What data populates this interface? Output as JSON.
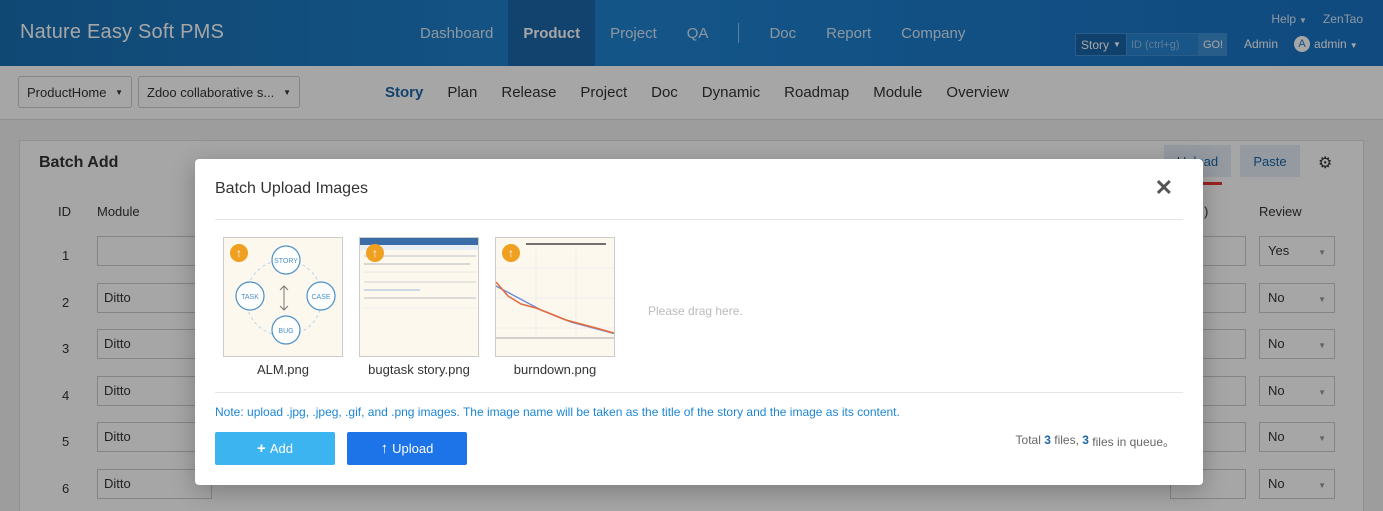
{
  "header": {
    "brand": "Nature Easy Soft PMS",
    "nav": [
      "Dashboard",
      "Product",
      "Project",
      "QA",
      "Doc",
      "Report",
      "Company"
    ],
    "active_nav": "Product",
    "help_label": "Help",
    "zentao_label": "ZenTao",
    "search_type": "Story",
    "search_placeholder": "ID (ctrl+g)",
    "search_go": "GO!",
    "admin_link": "Admin",
    "avatar_initial": "A",
    "user_name": "admin"
  },
  "subnav": {
    "product_crumb": "ProductHome",
    "project_crumb": "Zdoo collaborative s...",
    "items": [
      "Story",
      "Plan",
      "Release",
      "Project",
      "Doc",
      "Dynamic",
      "Roadmap",
      "Module",
      "Overview"
    ],
    "active_item": "Story"
  },
  "page": {
    "title": "Batch Add",
    "upload_label": "Upload",
    "paste_label": "Paste",
    "columns": {
      "id": "ID",
      "module": "Module",
      "paren": ")",
      "review": "Review"
    },
    "rows": [
      {
        "id": "1",
        "module": "",
        "review": "Yes"
      },
      {
        "id": "2",
        "module": "Ditto",
        "review": "No"
      },
      {
        "id": "3",
        "module": "Ditto",
        "review": "No"
      },
      {
        "id": "4",
        "module": "Ditto",
        "review": "No"
      },
      {
        "id": "5",
        "module": "Ditto",
        "review": "No"
      },
      {
        "id": "6",
        "module": "Ditto",
        "review": "No"
      }
    ]
  },
  "modal": {
    "title": "Batch Upload Images",
    "files": [
      {
        "name": "ALM.png"
      },
      {
        "name": "bugtask story.png"
      },
      {
        "name": "burndown.png"
      }
    ],
    "alm_labels": {
      "story": "STORY",
      "task": "TASK",
      "case": "CASE",
      "bug": "BUG"
    },
    "drag_hint": "Please drag here.",
    "note": "Note: upload .jpg, .jpeg, .gif, and .png images. The image name will be taken as the title of the story and the image as its content.",
    "add_label": "Add",
    "upload_label": "Upload",
    "summary": {
      "prefix": "Total ",
      "total": "3",
      "mid": " files, ",
      "queue": "3",
      "suffix": " files in queue。"
    }
  },
  "colors": {
    "accent": "#1c74e8",
    "add_button": "#3cb4f0",
    "badge": "#f0a020",
    "note": "#1c86d4"
  }
}
